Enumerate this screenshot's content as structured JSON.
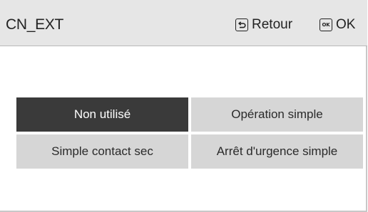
{
  "header": {
    "title": "CN_EXT",
    "back_label": "Retour",
    "ok_icon_text": "OK",
    "ok_label": "OK"
  },
  "options": [
    {
      "label": "Non utilisé",
      "selected": true
    },
    {
      "label": "Opération simple",
      "selected": false
    },
    {
      "label": "Simple contact sec",
      "selected": false
    },
    {
      "label": "Arrêt d'urgence simple",
      "selected": false
    }
  ],
  "icons": {
    "back": "return-icon",
    "ok": "ok-key-icon"
  },
  "colors": {
    "header_bg": "#e6e6e6",
    "selected_bg": "#3a3a3a",
    "option_bg": "#d6d6d6"
  }
}
